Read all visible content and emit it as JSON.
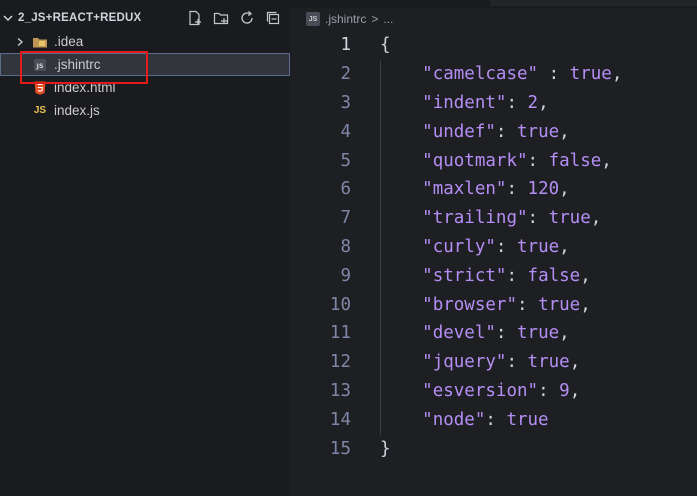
{
  "explorer": {
    "title": "2_JS+REACT+REDUX",
    "actions": [
      "new-file-icon",
      "new-folder-icon",
      "refresh-icon",
      "collapse-icon"
    ],
    "items": [
      {
        "label": ".idea",
        "type": "folder"
      },
      {
        "label": ".jshintrc",
        "type": "file"
      },
      {
        "label": "index.html",
        "type": "html"
      },
      {
        "label": "index.js",
        "type": "js"
      }
    ],
    "js_badge": "JS",
    "file_badge": "JS"
  },
  "editor": {
    "breadcrumb_file": ".jshintrc",
    "breadcrumb_sep": ">",
    "breadcrumb_more": "...",
    "lines": [
      {
        "n": "1",
        "key": "",
        "sep": "",
        "val": "",
        "text": "{"
      },
      {
        "n": "2",
        "key": "\"camelcase\"",
        "sep": " : ",
        "val": "true",
        "end": ","
      },
      {
        "n": "3",
        "key": "\"indent\"",
        "sep": ": ",
        "val": "2",
        "end": ","
      },
      {
        "n": "4",
        "key": "\"undef\"",
        "sep": ": ",
        "val": "true",
        "end": ","
      },
      {
        "n": "5",
        "key": "\"quotmark\"",
        "sep": ": ",
        "val": "false",
        "end": ","
      },
      {
        "n": "6",
        "key": "\"maxlen\"",
        "sep": ": ",
        "val": "120",
        "end": ","
      },
      {
        "n": "7",
        "key": "\"trailing\"",
        "sep": ": ",
        "val": "true",
        "end": ","
      },
      {
        "n": "8",
        "key": "\"curly\"",
        "sep": ": ",
        "val": "true",
        "end": ","
      },
      {
        "n": "9",
        "key": "\"strict\"",
        "sep": ": ",
        "val": "false",
        "end": ","
      },
      {
        "n": "10",
        "key": "\"browser\"",
        "sep": ": ",
        "val": "true",
        "end": ","
      },
      {
        "n": "11",
        "key": "\"devel\"",
        "sep": ": ",
        "val": "true",
        "end": ","
      },
      {
        "n": "12",
        "key": "\"jquery\"",
        "sep": ": ",
        "val": "true",
        "end": ","
      },
      {
        "n": "13",
        "key": "\"esversion\"",
        "sep": ": ",
        "val": "9",
        "end": ","
      },
      {
        "n": "14",
        "key": "\"node\"",
        "sep": ": ",
        "val": "true",
        "end": ""
      },
      {
        "n": "15",
        "key": "",
        "sep": "",
        "val": "",
        "text": "}"
      }
    ]
  },
  "colors": {
    "highlight": "#e01b1b",
    "syntax_key": "#b58ef5",
    "punctuation": "#cfd3dc",
    "line_number": "#7f86a8"
  }
}
